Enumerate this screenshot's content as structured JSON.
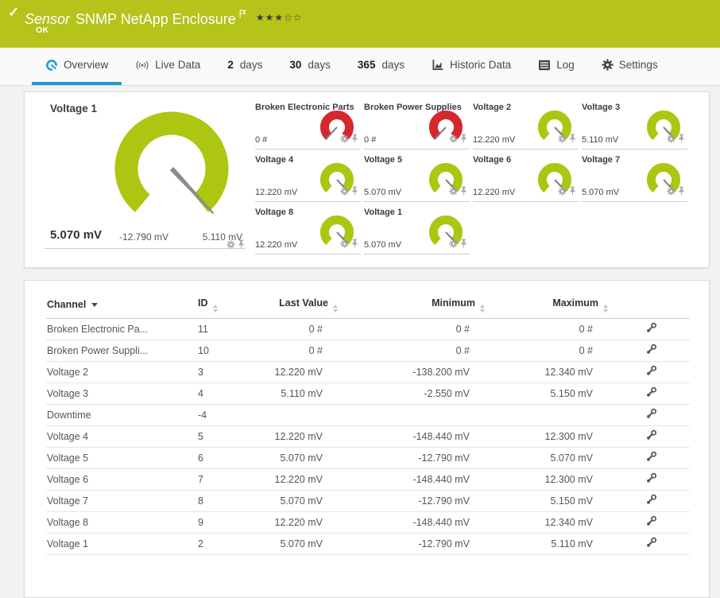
{
  "colors": {
    "header_green": "#b5c31b",
    "gauge_green": "#adc611",
    "gauge_red": "#d4282e",
    "accent_blue": "#1f9cd7",
    "needle_gray": "#8c8c8c"
  },
  "header": {
    "status_icon": "check-icon",
    "kind_label": "Sensor",
    "title": "SNMP NetApp Enclosure",
    "rating_stars": "★★★☆☆",
    "status": "OK"
  },
  "tabs": [
    {
      "label": "Overview",
      "icon": "gauge-icon",
      "active": true
    },
    {
      "label": "Live Data",
      "icon": "broadcast-icon",
      "active": false
    },
    {
      "number": "2",
      "label": "days",
      "active": false
    },
    {
      "number": "30",
      "label": "days",
      "active": false
    },
    {
      "number": "365",
      "label": "days",
      "active": false
    },
    {
      "label": "Historic Data",
      "icon": "chart-icon",
      "active": false
    },
    {
      "label": "Log",
      "icon": "log-icon",
      "active": false
    },
    {
      "label": "Settings",
      "icon": "gear-icon",
      "active": false
    }
  ],
  "gauges": {
    "main": {
      "title": "Voltage 1",
      "value": "5.070 mV",
      "min_label": "-12.790 mV",
      "max_label": "5.110 mV",
      "color": "green"
    },
    "tiles": [
      {
        "title": "Broken Electronic Parts",
        "value": "0 #",
        "color": "red"
      },
      {
        "title": "Broken Power Supplies",
        "value": "0 #",
        "color": "red"
      },
      {
        "title": "Voltage 2",
        "value": "12.220 mV",
        "color": "green"
      },
      {
        "title": "Voltage 3",
        "value": "5.110 mV",
        "color": "green"
      },
      {
        "title": "Voltage 4",
        "value": "12.220 mV",
        "color": "green"
      },
      {
        "title": "Voltage 5",
        "value": "5.070 mV",
        "color": "green"
      },
      {
        "title": "Voltage 6",
        "value": "12.220 mV",
        "color": "green"
      },
      {
        "title": "Voltage 7",
        "value": "5.070 mV",
        "color": "green"
      },
      {
        "title": "Voltage 8",
        "value": "12.220 mV",
        "color": "green"
      },
      {
        "title": "Voltage 1",
        "value": "5.070 mV",
        "color": "green"
      }
    ]
  },
  "table": {
    "columns": {
      "channel": "Channel",
      "id": "ID",
      "last_value": "Last Value",
      "minimum": "Minimum",
      "maximum": "Maximum"
    },
    "rows": [
      {
        "channel": "Broken Electronic Pa...",
        "id": "11",
        "last_value": "0 #",
        "minimum": "0 #",
        "maximum": "0 #"
      },
      {
        "channel": "Broken Power Suppli...",
        "id": "10",
        "last_value": "0 #",
        "minimum": "0 #",
        "maximum": "0 #"
      },
      {
        "channel": "Voltage 2",
        "id": "3",
        "last_value": "12.220 mV",
        "minimum": "-138.200 mV",
        "maximum": "12.340 mV"
      },
      {
        "channel": "Voltage 3",
        "id": "4",
        "last_value": "5.110 mV",
        "minimum": "-2.550 mV",
        "maximum": "5.150 mV"
      },
      {
        "channel": "Downtime",
        "id": "-4",
        "last_value": "",
        "minimum": "",
        "maximum": ""
      },
      {
        "channel": "Voltage 4",
        "id": "5",
        "last_value": "12.220 mV",
        "minimum": "-148.440 mV",
        "maximum": "12.300 mV"
      },
      {
        "channel": "Voltage 5",
        "id": "6",
        "last_value": "5.070 mV",
        "minimum": "-12.790 mV",
        "maximum": "5.070 mV"
      },
      {
        "channel": "Voltage 6",
        "id": "7",
        "last_value": "12.220 mV",
        "minimum": "-148.440 mV",
        "maximum": "12.300 mV"
      },
      {
        "channel": "Voltage 7",
        "id": "8",
        "last_value": "5.070 mV",
        "minimum": "-12.790 mV",
        "maximum": "5.150 mV"
      },
      {
        "channel": "Voltage 8",
        "id": "9",
        "last_value": "12.220 mV",
        "minimum": "-148.440 mV",
        "maximum": "12.340 mV"
      },
      {
        "channel": "Voltage 1",
        "id": "2",
        "last_value": "5.070 mV",
        "minimum": "-12.790 mV",
        "maximum": "5.110 mV"
      }
    ]
  }
}
